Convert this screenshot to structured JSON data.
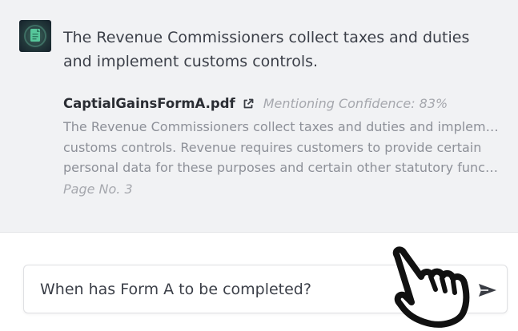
{
  "message": {
    "avatar_icon": "document-bot-icon",
    "answer": "The Revenue Commissioners collect taxes and duties and implement customs controls.",
    "source": {
      "file_name": "CaptialGainsFormA.pdf",
      "link_icon": "external-link-icon",
      "confidence": "Mentioning Confidence: 83%",
      "excerpt_lines": [
        "The Revenue Commissioners collect taxes and duties and implement",
        "customs controls. Revenue requires customers to provide certain",
        "personal data for these purposes and certain other statutory function…"
      ],
      "page": "Page No. 3"
    }
  },
  "composer": {
    "value": "When has Form A to be completed?",
    "send_icon": "send-icon"
  },
  "cursor": {
    "icon": "hand-pointer-icon"
  }
}
